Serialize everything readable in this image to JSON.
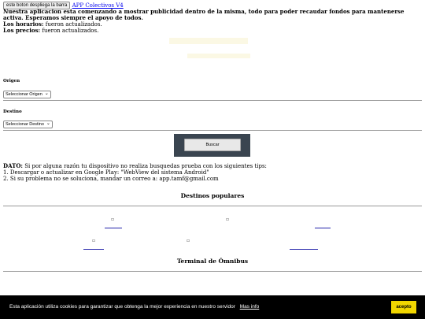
{
  "header": {
    "toggle_label": "este boton despliega la barra",
    "app_link": "APP Colectivos V4",
    "notice": "Nuestra aplicacion esta comenzando a mostrar publicidad dentro de la misma, todo para poder recaudar fondos para mantenerse activa. Esperamos siempre el apoyo de todos.",
    "horarios_label": "Los horarios:",
    "horarios_value": "fueron actualizados.",
    "precios_label": "Los precios:",
    "precios_value": "fueron actualizados."
  },
  "form": {
    "origen_label": "Origen",
    "origen_selected": "Seleccionar Origen",
    "destino_label": "Destino",
    "destino_selected": "Seleccionar Destino",
    "search_label": "Buscar"
  },
  "tips": {
    "dato_label": "DATO:",
    "dato_text": "Si por alguna razón tu dispositivo no realiza busquedas prueba con los siguientes tips:",
    "tip1": "1. Descargar o actualizar en Google Play: \"WebView del sistema Android\"",
    "tip2": "2. Si su problema no se soluciona, mandar un correo a: app.tamf@gmail.com"
  },
  "sections": {
    "popular": "Destinos populares",
    "terminal": "Terminal de Ómnibus"
  },
  "cookie": {
    "text": "Esta aplicación utiliza cookies para garantizar que obtenga la mejor experiencia en nuestro servidor",
    "more_info": "Mas info",
    "accept": "acepto"
  },
  "colors": {
    "search_panel": "#3a4550",
    "cookie_bg": "#000000",
    "accept_bg": "#f1d600"
  }
}
